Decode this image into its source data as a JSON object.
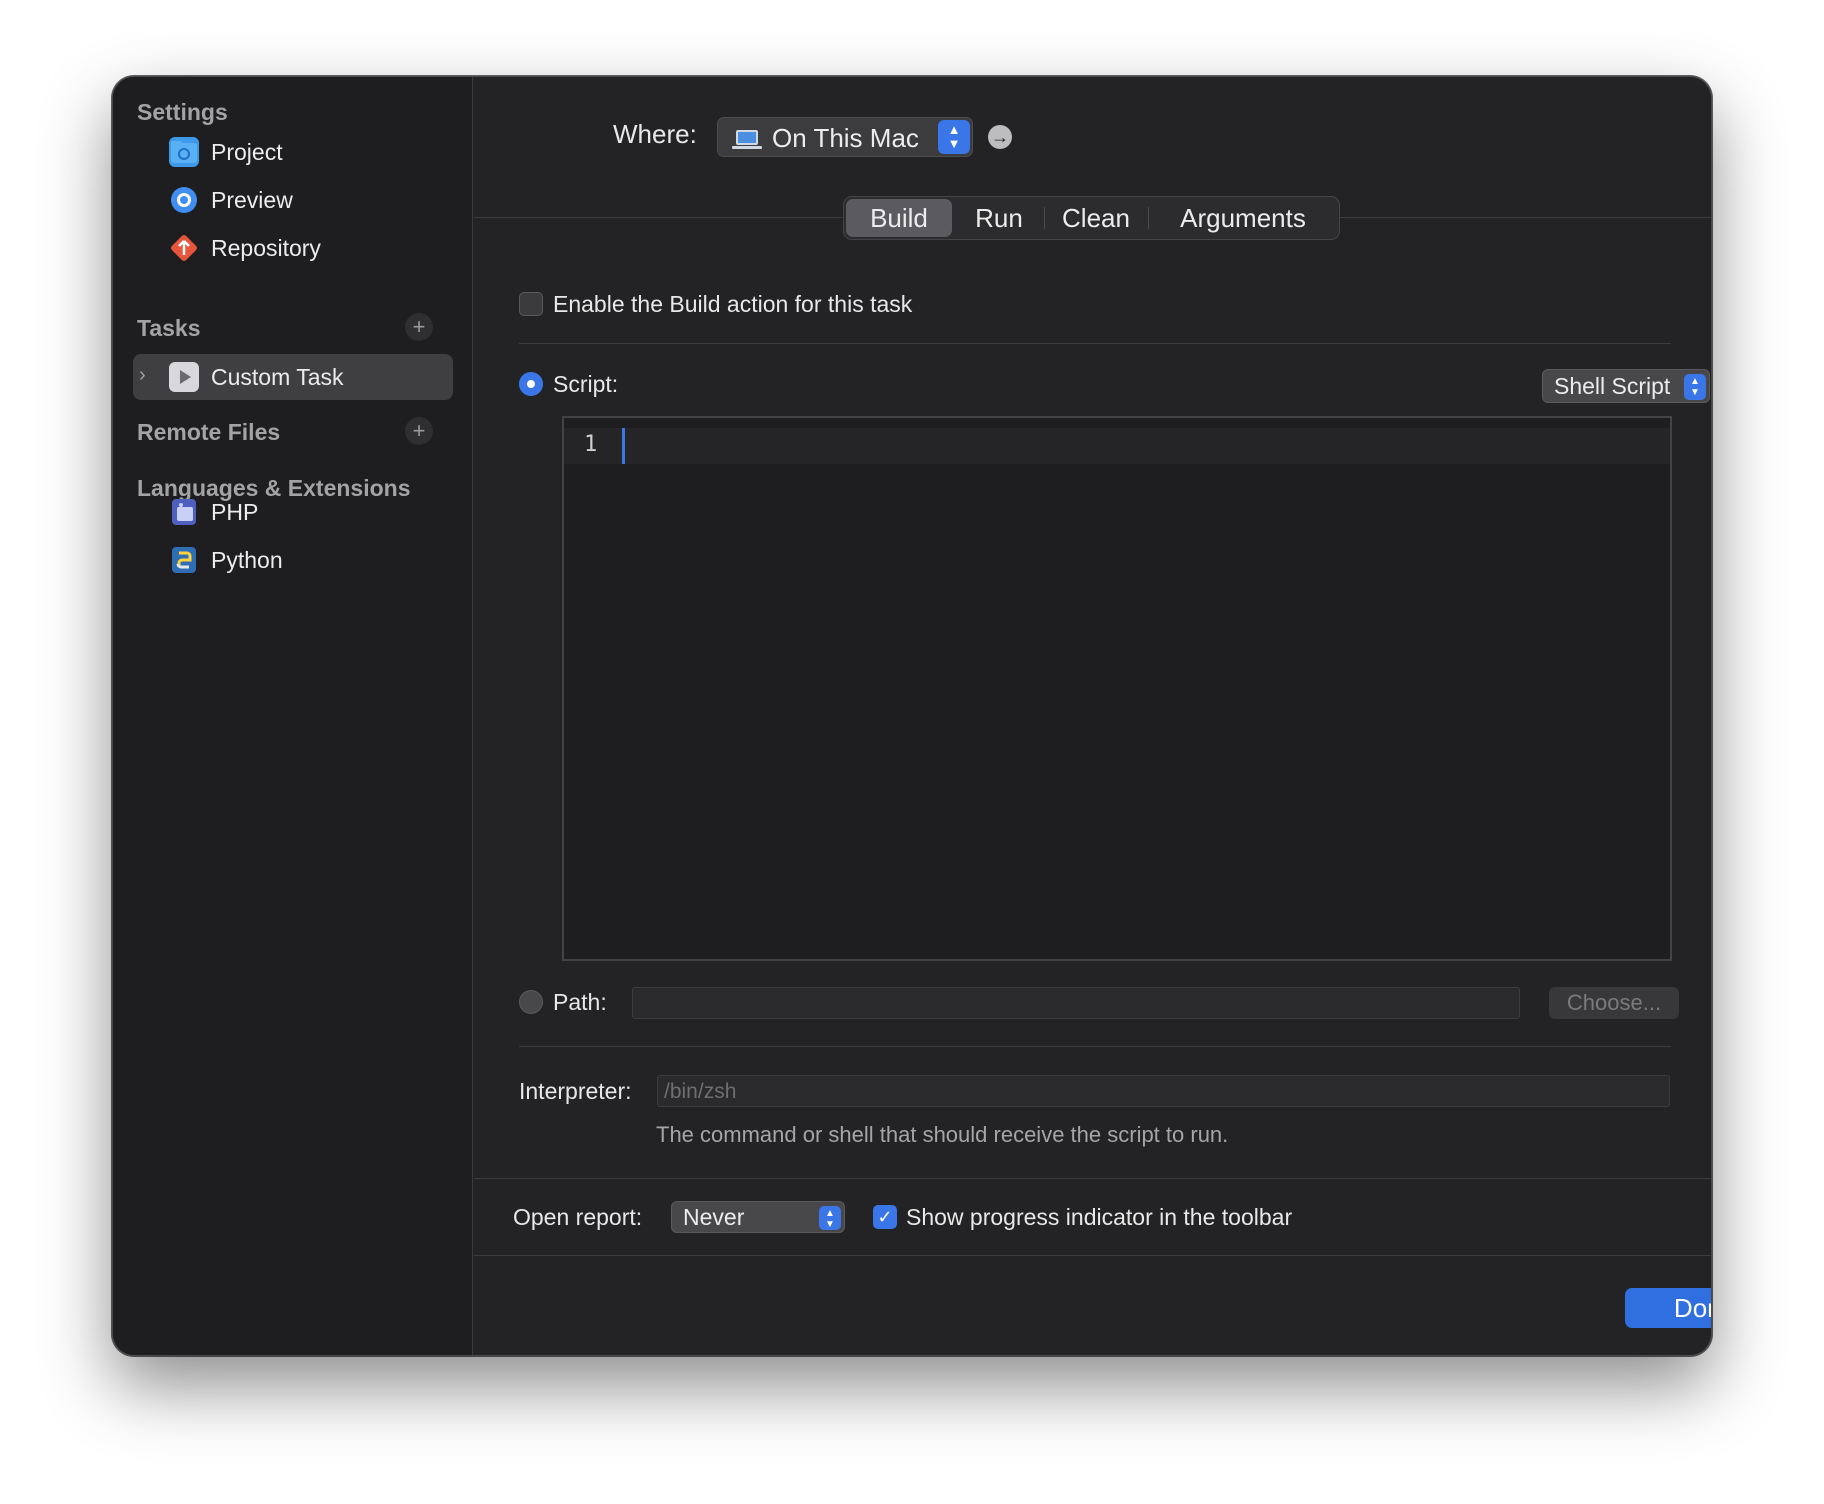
{
  "sidebar": {
    "settings_header": "Settings",
    "settings_items": [
      {
        "label": "Project",
        "icon": "folder-icon"
      },
      {
        "label": "Preview",
        "icon": "preview-icon"
      },
      {
        "label": "Repository",
        "icon": "git-icon"
      }
    ],
    "tasks_header": "Tasks",
    "tasks_items": [
      {
        "label": "Custom Task",
        "icon": "play-icon",
        "selected": true
      }
    ],
    "remote_header": "Remote Files",
    "languages_header": "Languages & Extensions",
    "languages_items": [
      {
        "label": "PHP",
        "icon": "php-icon"
      },
      {
        "label": "Python",
        "icon": "python-icon"
      }
    ]
  },
  "header": {
    "where_label": "Where:",
    "where_value": "On This Mac"
  },
  "tabs": [
    "Build",
    "Run",
    "Clean",
    "Arguments"
  ],
  "active_tab": "Build",
  "build": {
    "enable_label": "Enable the Build action for this task",
    "enable_checked": false,
    "script_label": "Script:",
    "script_type": "Shell Script",
    "shebang_label": "#!",
    "editor_line_number": "1",
    "path_label": "Path:",
    "path_value": "",
    "choose_label": "Choose...",
    "interpreter_label": "Interpreter:",
    "interpreter_placeholder": "/bin/zsh",
    "interpreter_help": "The command or shell that should receive the script to run."
  },
  "footer": {
    "open_report_label": "Open report:",
    "open_report_value": "Never",
    "progress_label": "Show progress indicator in the toolbar",
    "progress_checked": true,
    "done_label": "Done"
  },
  "colors": {
    "accent": "#3a76e8",
    "window_bg": "#232325",
    "sidebar_bg": "#1e1e20"
  }
}
